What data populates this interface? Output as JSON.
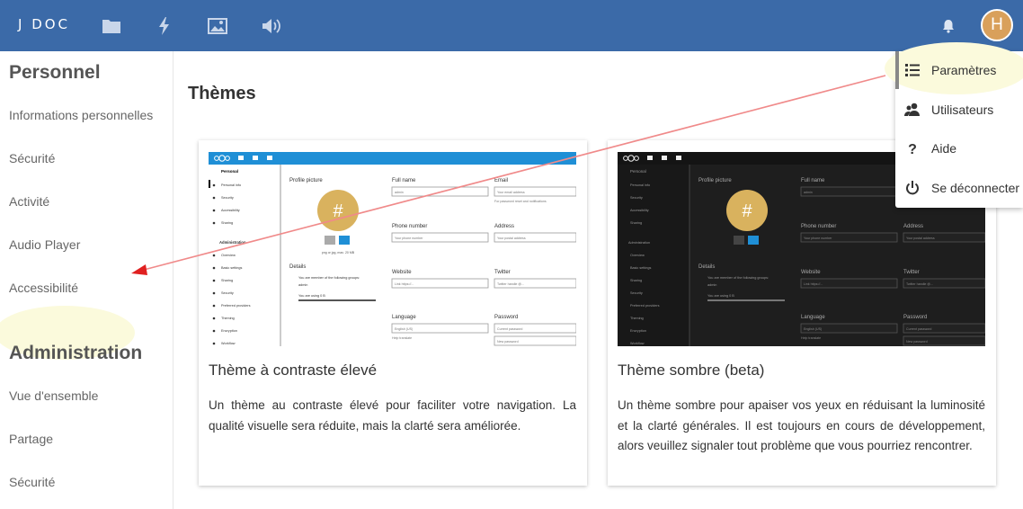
{
  "topbar": {
    "logo": "J DOC",
    "icons": [
      "folder-icon",
      "lightning-icon",
      "image-icon",
      "speaker-icon"
    ],
    "notification_icon": "bell-icon",
    "avatar_initial": "H",
    "avatar_color": "#d9a05b",
    "bar_color": "#3b6aa8"
  },
  "sidebar": {
    "personal_heading": "Personnel",
    "personal_items": [
      "Informations personnelles",
      "Sécurité",
      "Activité",
      "Audio Player",
      "Accessibilité"
    ],
    "admin_heading": "Administration",
    "admin_items": [
      "Vue d'ensemble",
      "Partage",
      "Sécurité"
    ]
  },
  "main": {
    "title": "Thèmes",
    "cards": [
      {
        "title": "Thème à contraste élevé",
        "description": "Un thème au contraste élevé pour faciliter votre navigation. La qualité visuelle sera réduite, mais la clarté sera améliorée.",
        "preview": {
          "sidebar_heading": "Personal",
          "sidebar_items": [
            "Personal info",
            "Security",
            "Accessibility",
            "Sharing"
          ],
          "admin_heading": "Administration",
          "admin_items": [
            "Overview",
            "Basic settings",
            "Sharing",
            "Security",
            "Preferred providers",
            "Theming",
            "Encryption",
            "Workflow"
          ],
          "profile_picture": "Profile picture",
          "avatar_symbol": "#",
          "hint": "png or jpg, max. 20 MB",
          "details": "Details",
          "details_line1": "You are member of the following groups:",
          "details_group": "admin",
          "details_line2": "You are using 0 B",
          "full_name": "Full name",
          "full_name_value": "admin",
          "email": "Email",
          "email_placeholder": "Your email address",
          "email_hint": "For password reset and notifications",
          "phone": "Phone number",
          "phone_placeholder": "Your phone number",
          "address": "Address",
          "address_placeholder": "Your postal address",
          "website": "Website",
          "website_placeholder": "Link https://...",
          "twitter": "Twitter",
          "twitter_placeholder": "Twitter handle @...",
          "language": "Language",
          "language_value": "English (US)",
          "language_hint": "Help translate",
          "password": "Password",
          "password_current": "Current password",
          "password_new": "New password"
        }
      },
      {
        "title": "Thème sombre (beta)",
        "description": "Un thème sombre pour apaiser vos yeux en réduisant la luminosité et la clarté générales. Il est toujours en cours de développement, alors veuillez signaler tout problème que vous pourriez rencontrer.",
        "preview": {
          "sidebar_heading": "Personal",
          "sidebar_items": [
            "Personal info",
            "Security",
            "Accessibility",
            "Sharing"
          ],
          "admin_heading": "Administration",
          "admin_items": [
            "Overview",
            "Basic settings",
            "Sharing",
            "Security",
            "Preferred providers",
            "Theming",
            "Encryption",
            "Workflow"
          ],
          "profile_picture": "Profile picture",
          "avatar_symbol": "#",
          "details": "Details",
          "details_line1": "You are member of the following groups:",
          "details_group": "admin",
          "details_line2": "You are using 0 B",
          "full_name": "Full name",
          "full_name_value": "admin",
          "phone": "Phone number",
          "phone_placeholder": "Your phone number",
          "address": "Address",
          "address_placeholder": "Your postal address",
          "website": "Website",
          "website_placeholder": "Link https://...",
          "twitter": "Twitter",
          "twitter_placeholder": "Twitter handle @...",
          "language": "Language",
          "language_value": "English (US)",
          "language_hint": "Help translate",
          "password": "Password",
          "password_current": "Current password",
          "password_new": "New password"
        }
      }
    ]
  },
  "dropdown": {
    "items": [
      {
        "label": "Paramètres",
        "icon": "settings-list-icon"
      },
      {
        "label": "Utilisateurs",
        "icon": "users-icon"
      },
      {
        "label": "Aide",
        "icon": "help-icon"
      },
      {
        "label": "Se déconnecter",
        "icon": "power-icon"
      }
    ]
  },
  "colors": {
    "highlight": "#fbfadc",
    "arrow": "#f08080",
    "preview_header": "#1f8fd6",
    "dark_bg": "#1e1e1e"
  }
}
